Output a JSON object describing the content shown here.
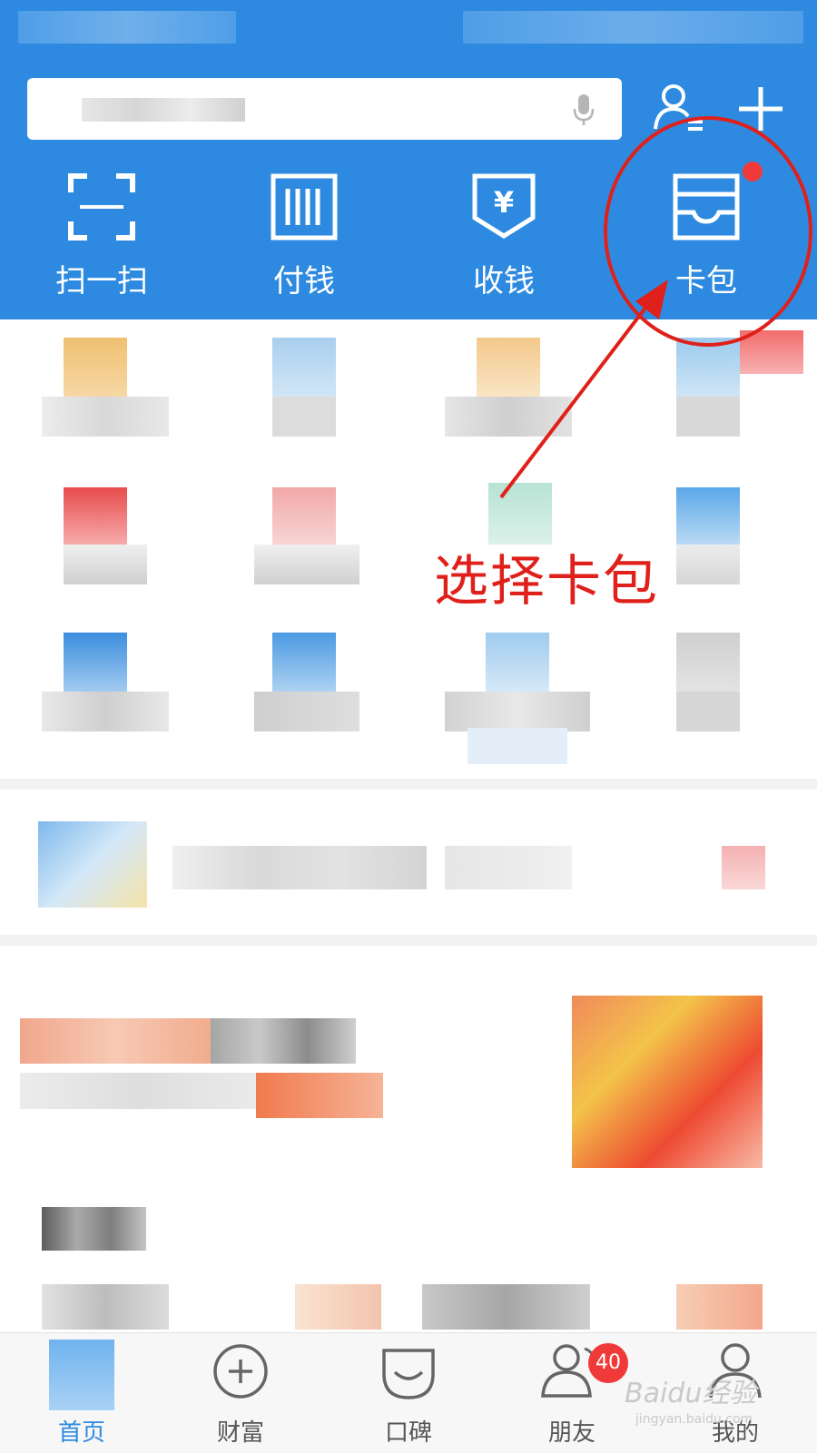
{
  "header": {
    "quick_actions": [
      {
        "label": "扫一扫",
        "icon": "scan-icon"
      },
      {
        "label": "付钱",
        "icon": "pay-barcode-icon"
      },
      {
        "label": "收钱",
        "icon": "receive-money-icon"
      },
      {
        "label": "卡包",
        "icon": "card-wallet-icon"
      }
    ],
    "search_icons": [
      "microphone-icon",
      "contacts-icon",
      "plus-icon"
    ]
  },
  "annotation": {
    "text": "选择卡包"
  },
  "tabbar": {
    "tabs": [
      {
        "label": "首页",
        "icon": "home-icon",
        "active": true
      },
      {
        "label": "财富",
        "icon": "wealth-icon",
        "active": false
      },
      {
        "label": "口碑",
        "icon": "koubei-icon",
        "active": false
      },
      {
        "label": "朋友",
        "icon": "friends-icon",
        "active": false,
        "badge": "40"
      },
      {
        "label": "我的",
        "icon": "profile-icon",
        "active": false
      }
    ]
  },
  "watermark": {
    "text": "Baidu经验",
    "subtext": "jingyan.baidu.com"
  },
  "colors": {
    "header_blue": "#2d8ae0",
    "annotation_red": "#e0201a",
    "badge_red": "#f03a3a"
  }
}
